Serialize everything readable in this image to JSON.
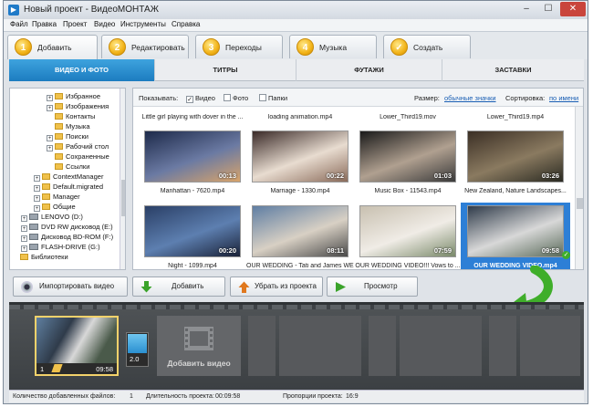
{
  "window": {
    "title": "Новый проект - ВидеоМОНТАЖ",
    "controls": [
      "–",
      "☐",
      "✕"
    ]
  },
  "menu": [
    "Файл",
    "Правка",
    "Проект",
    "Видео",
    "Инструменты",
    "Справка"
  ],
  "steps": [
    {
      "num": "1",
      "label": "Добавить",
      "active": true
    },
    {
      "num": "2",
      "label": "Редактировать"
    },
    {
      "num": "3",
      "label": "Переходы"
    },
    {
      "num": "4",
      "label": "Музыка"
    },
    {
      "num": "✓",
      "label": "Создать"
    }
  ],
  "categories": [
    "ВИДЕО И ФОТО",
    "ТИТРЫ",
    "ФУТАЖИ",
    "ЗАСТАВКИ"
  ],
  "tree": [
    {
      "label": "Избранное",
      "type": "folder",
      "level": 3,
      "exp": "+"
    },
    {
      "label": "Изображения",
      "type": "folder",
      "level": 3,
      "exp": "+"
    },
    {
      "label": "Контакты",
      "type": "folder",
      "level": 3,
      "exp": ""
    },
    {
      "label": "Музыка",
      "type": "folder",
      "level": 3,
      "exp": ""
    },
    {
      "label": "Поиски",
      "type": "folder",
      "level": 3,
      "exp": "+"
    },
    {
      "label": "Рабочий стол",
      "type": "folder",
      "level": 3,
      "exp": "+"
    },
    {
      "label": "Сохраненные",
      "type": "folder",
      "level": 3,
      "exp": ""
    },
    {
      "label": "Ссылки",
      "type": "folder",
      "level": 3,
      "exp": ""
    },
    {
      "label": "ContextManager",
      "type": "folder",
      "level": 2,
      "exp": "+"
    },
    {
      "label": "Default.migrated",
      "type": "folder",
      "level": 2,
      "exp": "+"
    },
    {
      "label": "Manager",
      "type": "folder",
      "level": 2,
      "exp": "+"
    },
    {
      "label": "Общие",
      "type": "folder",
      "level": 2,
      "exp": "+"
    },
    {
      "label": "LENOVO (D:)",
      "type": "drive",
      "level": 1,
      "exp": "+"
    },
    {
      "label": "DVD RW дисковод (E:)",
      "type": "drive",
      "level": 1,
      "exp": "+"
    },
    {
      "label": "Дисковод BD-ROM (F:)",
      "type": "drive",
      "level": 1,
      "exp": "+"
    },
    {
      "label": "FLASH-DRIVE (G:)",
      "type": "drive",
      "level": 1,
      "exp": "+"
    },
    {
      "label": "Библиотеки",
      "type": "folder",
      "level": 0,
      "exp": ""
    }
  ],
  "gallery_toolbar": {
    "show_label": "Показывать:",
    "filters": [
      {
        "label": "Видео",
        "checked": true
      },
      {
        "label": "Фото",
        "checked": false
      },
      {
        "label": "Папки",
        "checked": false
      }
    ],
    "size_label": "Размер:",
    "size_value": "обычные значки",
    "sort_label": "Сортировка:",
    "sort_value": "по имени"
  },
  "top_titles": [
    "Little girl playing with dover in the ...",
    "loading animation.mp4",
    "Lower_Third19.mov",
    "Lower_Third19.mp4"
  ],
  "videos": [
    {
      "name": "Manhattan - 7620.mp4",
      "duration": "00:13",
      "colors": [
        "#1d2a4a",
        "#6b7aa3",
        "#d9a46a"
      ]
    },
    {
      "name": "Marriage - 1330.mp4",
      "duration": "00:22",
      "colors": [
        "#3a2a28",
        "#e8dcd0",
        "#8a6b5a"
      ]
    },
    {
      "name": "Music Box - 11543.mp4",
      "duration": "01:03",
      "colors": [
        "#1a1a1a",
        "#b0a090",
        "#3a3a3a"
      ]
    },
    {
      "name": "New Zealand, Nature Landscapes...",
      "duration": "03:26",
      "colors": [
        "#3b2f25",
        "#8a7a60",
        "#2a2a22"
      ]
    },
    {
      "name": "Night - 1099.mp4",
      "duration": "00:20",
      "colors": [
        "#2a3f66",
        "#5d7fb0",
        "#1a2238"
      ]
    },
    {
      "name": "OUR WEDDING - Tati and James WE...",
      "duration": "08:11",
      "colors": [
        "#5f7ea3",
        "#d8d0c4",
        "#4a4a4a"
      ]
    },
    {
      "name": "OUR WEDDING VIDEO!!! Vows to ...",
      "duration": "07:59",
      "colors": [
        "#c8c0b0",
        "#f0ece6",
        "#7a8a6a"
      ]
    },
    {
      "name": "OUR WEDDING VIDEO.mp4",
      "duration": "09:58",
      "colors": [
        "#2f3b4a",
        "#d8d8d8",
        "#5a6b5a"
      ],
      "selected": true
    }
  ],
  "actions": [
    {
      "label": "Импортировать видео",
      "icon": "webcam-icon"
    },
    {
      "label": "Добавить",
      "icon": "green-down-arrow-icon"
    },
    {
      "label": "Убрать из проекта",
      "icon": "orange-up-arrow-icon"
    },
    {
      "label": "Просмотр",
      "icon": "green-play-icon"
    }
  ],
  "storyboard": {
    "clip": {
      "index": "1",
      "duration": "09:58"
    },
    "transition_duration": "2.0",
    "add_video_label": "Добавить видео"
  },
  "status": {
    "files_label": "Количество добавленных файлов:",
    "files_value": "1",
    "duration_label": "Длительность проекта:",
    "duration_value": "00:09:58",
    "ratio_label": "Пропорции проекта:",
    "ratio_value": "16:9"
  },
  "colors": {
    "accent": "#1f86cf",
    "selection": "#2d7fd6",
    "arrow": "#3fae2a",
    "highlight": "#f4d26b"
  }
}
